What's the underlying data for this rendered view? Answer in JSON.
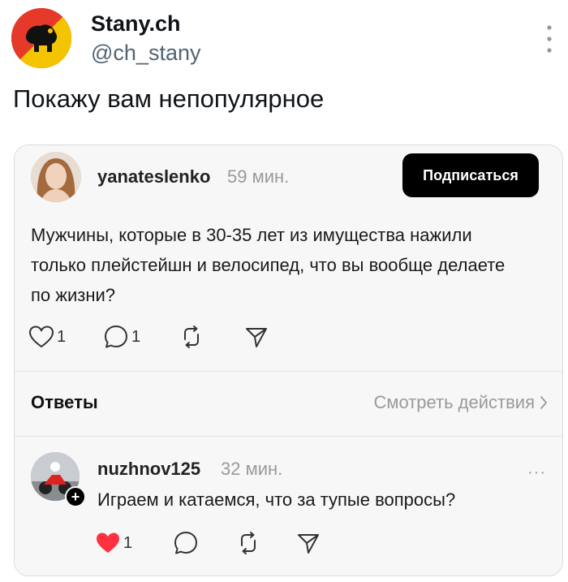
{
  "tweet": {
    "author_name": "Stany.ch",
    "author_handle": "@ch_stany",
    "text": "Покажу вам непопулярное"
  },
  "embedded_post": {
    "username": "yanateslenko",
    "time": "59 мин.",
    "subscribe_label": "Подписаться",
    "body": "Мужчины, которые в 30-35 лет из имущества нажили только плейстейшн и велосипед, что вы вообще делаете по жизни?",
    "likes": "1",
    "comments": "1",
    "replies_title": "Ответы",
    "view_activity": "Смотреть действия"
  },
  "reply": {
    "username": "nuzhnov125",
    "time": "32 мин.",
    "more": "···",
    "follow_symbol": "+",
    "body": "Играем и катаемся, что за тупые вопросы?",
    "likes": "1"
  },
  "colors": {
    "liked": "#ff3040",
    "avatar_red": "#e53929",
    "avatar_yellow": "#f5c400"
  },
  "icons": [
    "coat-of-arms-icon",
    "more-vertical-icon",
    "heart-icon",
    "comment-icon",
    "repost-icon",
    "share-icon",
    "chevron-right-icon"
  ]
}
